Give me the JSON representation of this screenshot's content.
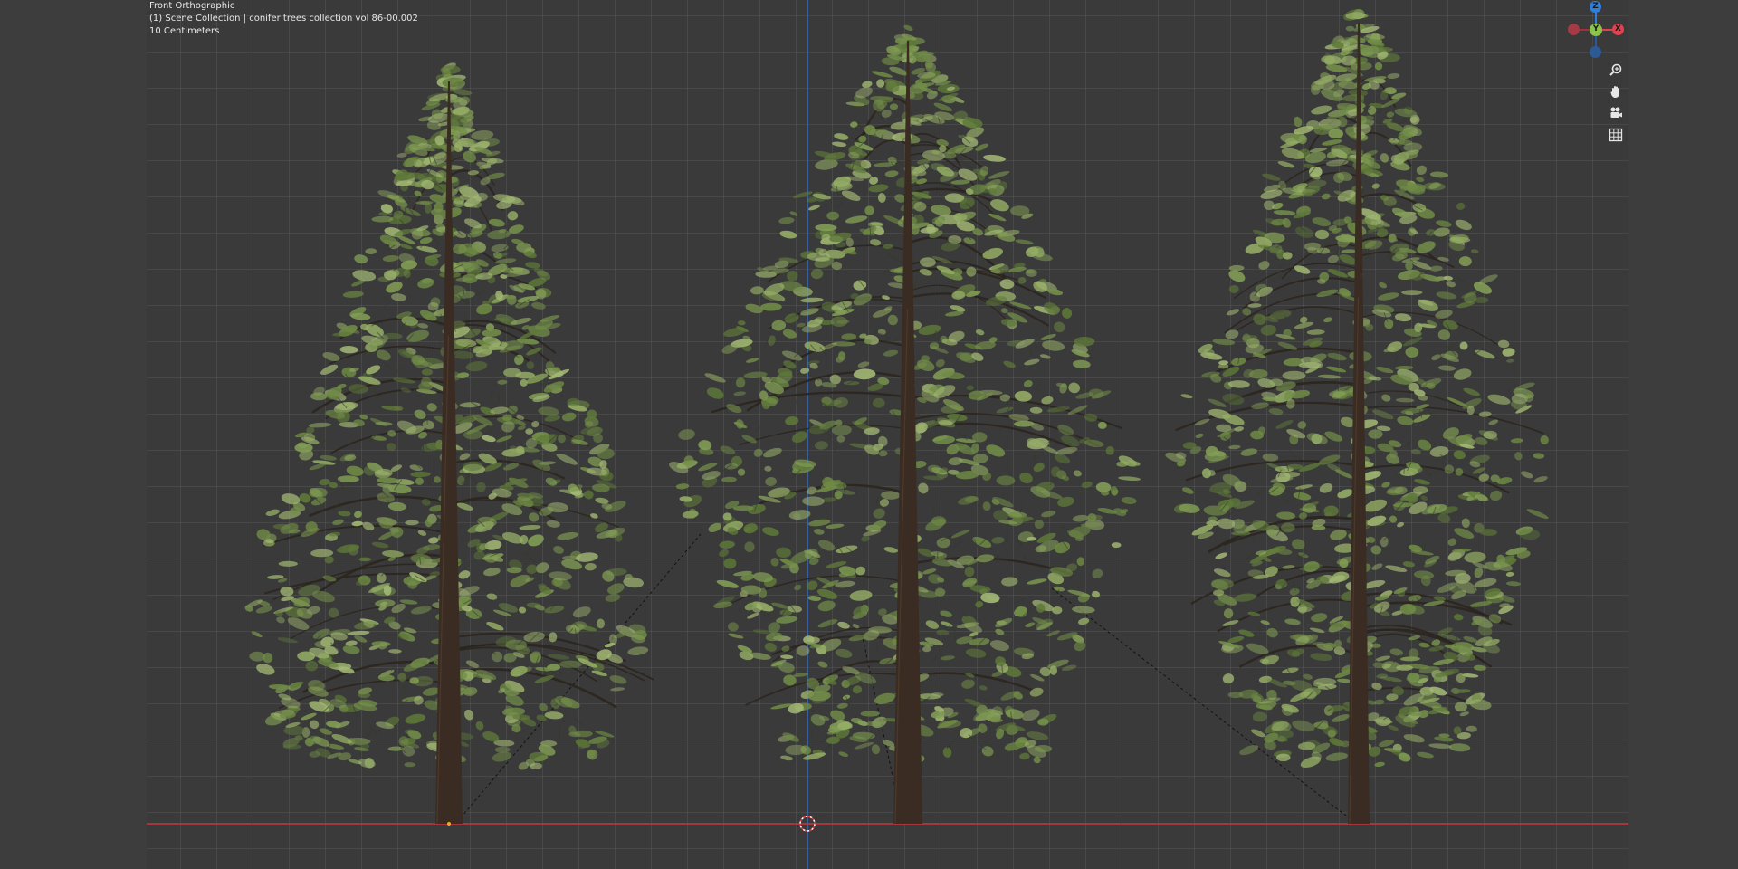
{
  "viewport_info": {
    "view_name": "Front Orthographic",
    "collection_line": "(1) Scene Collection | conifer trees collection vol 86-00.002",
    "grid_scale": "10 Centimeters"
  },
  "gizmo": {
    "z_label": "Z",
    "y_label": "Y",
    "x_label": "X",
    "x_color": "#e0414f",
    "y_color": "#8bc34a",
    "z_color": "#2f7fd9"
  },
  "tools": [
    {
      "name": "zoom-icon"
    },
    {
      "name": "pan-hand-icon"
    },
    {
      "name": "camera-view-icon"
    },
    {
      "name": "ortho-grid-icon"
    }
  ],
  "colors": {
    "background": "#3d3d3d",
    "grid_line": "#4a4a4a",
    "x_axis": "#c9353e",
    "z_axis": "#3b6fc4",
    "foliage": "#7f9a52",
    "trunk": "#3a2c22"
  }
}
